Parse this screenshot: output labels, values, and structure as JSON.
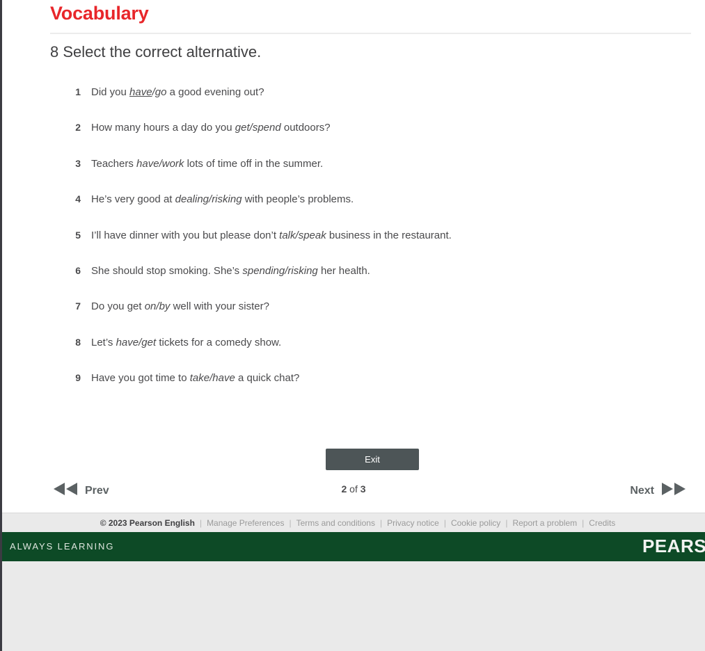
{
  "header": {
    "title": "Vocabulary",
    "instruction": "8 Select the correct alternative."
  },
  "exercise": {
    "items": [
      {
        "number": "1",
        "before": "Did you ",
        "option_a": "have",
        "option_a_selected": true,
        "slash": "/",
        "option_b": "go",
        "option_b_selected": false,
        "after": " a good evening out?"
      },
      {
        "number": "2",
        "before": "How many hours a day do you ",
        "option_a": "get",
        "option_a_selected": false,
        "slash": "/",
        "option_b": "spend",
        "option_b_selected": false,
        "after": " outdoors?"
      },
      {
        "number": "3",
        "before": "Teachers ",
        "option_a": "have",
        "option_a_selected": false,
        "slash": "/",
        "option_b": "work",
        "option_b_selected": false,
        "after": " lots of time off in the summer."
      },
      {
        "number": "4",
        "before": "He’s very good at ",
        "option_a": "dealing",
        "option_a_selected": false,
        "slash": "/",
        "option_b": "risking",
        "option_b_selected": false,
        "after": " with people’s problems."
      },
      {
        "number": "5",
        "before": "I’ll have dinner with you but please don’t ",
        "option_a": "talk",
        "option_a_selected": false,
        "slash": "/",
        "option_b": "speak",
        "option_b_selected": false,
        "after": " business in the restaurant."
      },
      {
        "number": "6",
        "before": "She should stop smoking. She’s ",
        "option_a": "spending",
        "option_a_selected": false,
        "slash": "/",
        "option_b": "risking",
        "option_b_selected": false,
        "after": " her health."
      },
      {
        "number": "7",
        "before": "Do you get ",
        "option_a": "on",
        "option_a_selected": false,
        "slash": "/",
        "option_b": "by",
        "option_b_selected": false,
        "after": " well with your sister?"
      },
      {
        "number": "8",
        "before": "Let’s ",
        "option_a": "have",
        "option_a_selected": false,
        "slash": "/",
        "option_b": "get",
        "option_b_selected": false,
        "after": " tickets for a comedy show."
      },
      {
        "number": "9",
        "before": "Have you got time to ",
        "option_a": "take",
        "option_a_selected": false,
        "slash": "/",
        "option_b": "have",
        "option_b_selected": false,
        "after": " a quick chat?"
      }
    ]
  },
  "controls": {
    "exit_label": "Exit",
    "prev_label": "Prev",
    "next_label": "Next",
    "page_current": "2",
    "page_of": " of ",
    "page_total": "3"
  },
  "footer": {
    "copyright": "© 2023 Pearson English",
    "separator": "|",
    "links": [
      "Manage Preferences",
      "Terms and conditions",
      "Privacy notice",
      "Cookie policy",
      "Report a problem",
      "Credits"
    ]
  },
  "brand": {
    "tagline": "ALWAYS LEARNING",
    "wordmark": "PEARSON"
  },
  "colors": {
    "title_red": "#e8262a",
    "brand_green": "#0d4a26",
    "button_gray": "#4d5557",
    "text_gray": "#4a4a4c"
  }
}
